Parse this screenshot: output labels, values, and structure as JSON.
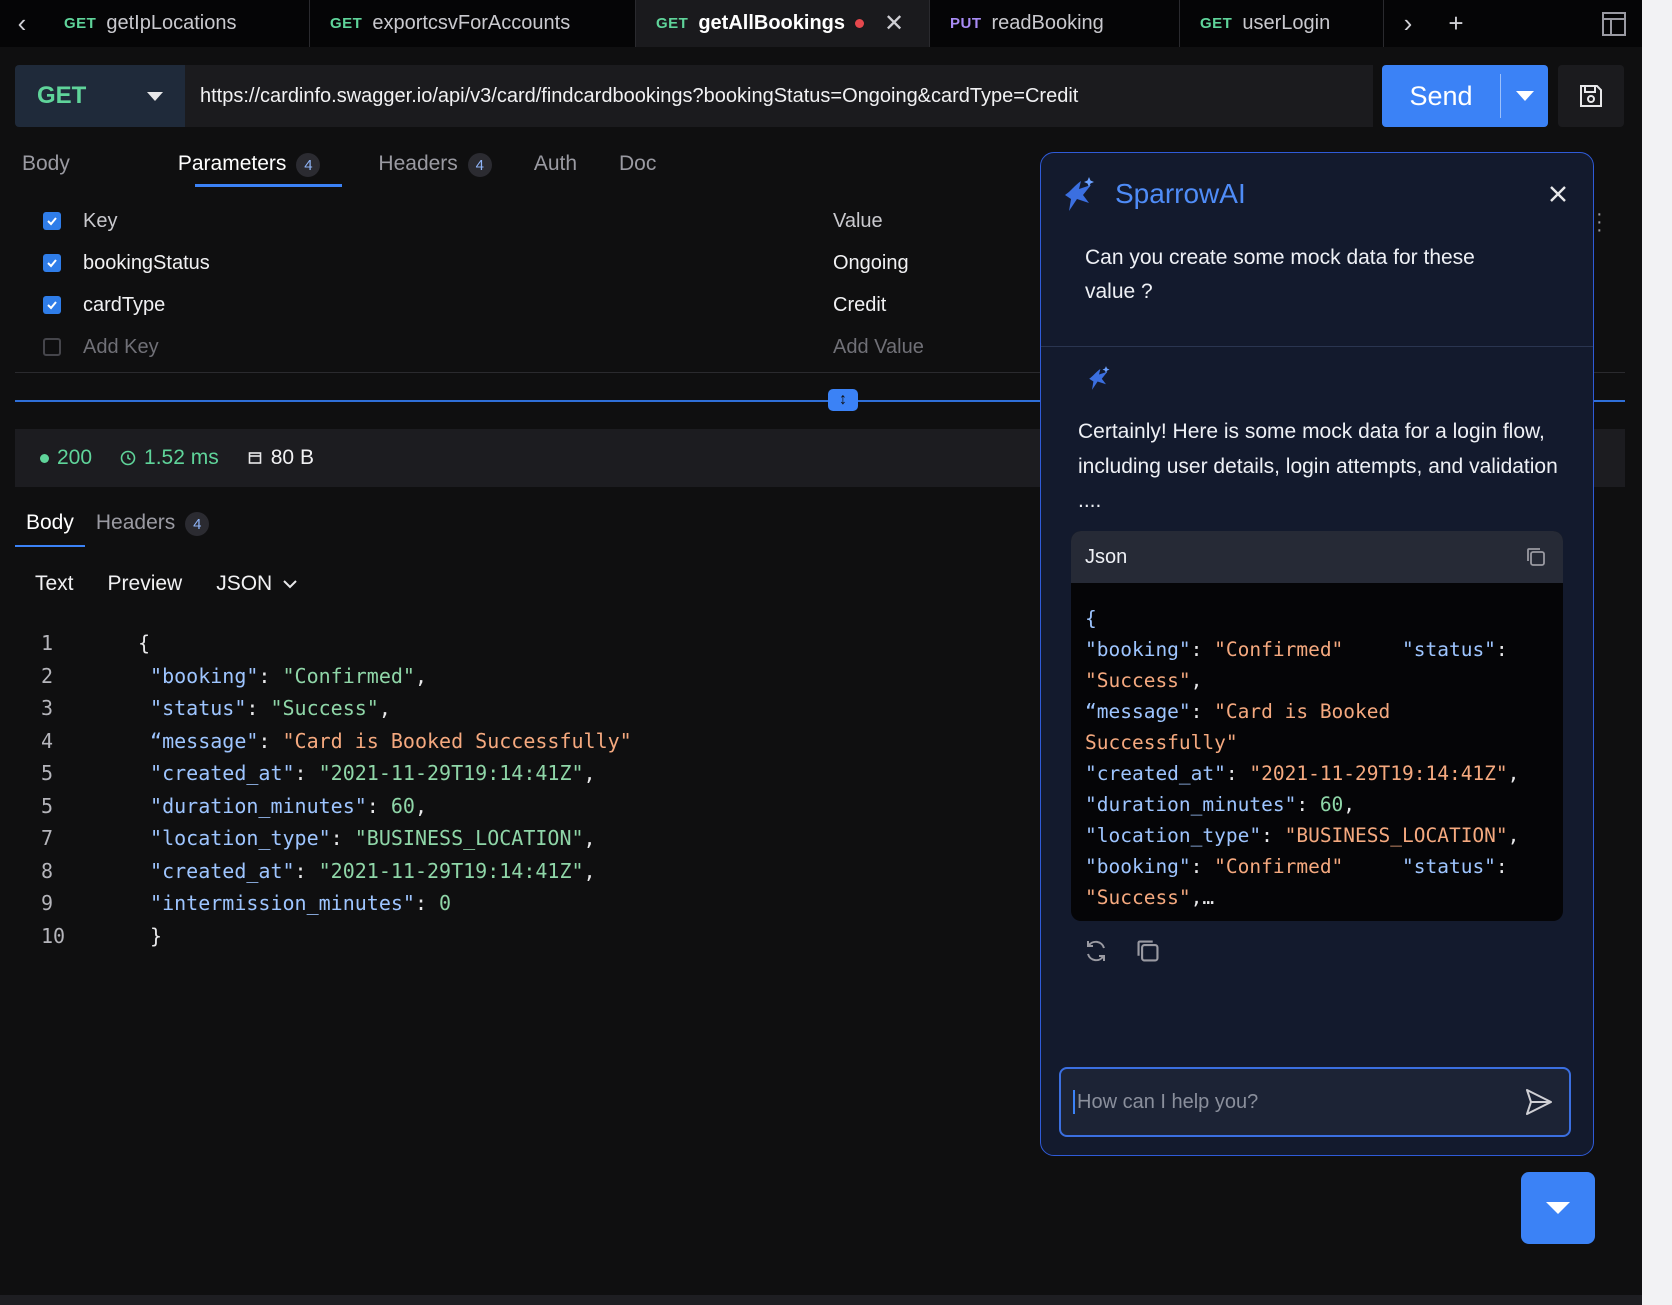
{
  "tabs": [
    {
      "method": "GET",
      "name": "getIpLocations",
      "active": false
    },
    {
      "method": "GET",
      "name": "exportcsvForAccounts",
      "active": false
    },
    {
      "method": "GET",
      "name": "getAllBookings",
      "active": true
    },
    {
      "method": "PUT",
      "name": "readBooking",
      "active": false
    },
    {
      "method": "GET",
      "name": "userLogin",
      "active": false
    }
  ],
  "request": {
    "method": "GET",
    "url": "https://cardinfo.swagger.io/api/v3/card/findcardbookings?bookingStatus=Ongoing&cardType=Credit",
    "send_label": "Send"
  },
  "request_tabs": [
    {
      "label": "Body",
      "badge": ""
    },
    {
      "label": "Parameters",
      "badge": "4"
    },
    {
      "label": "Headers",
      "badge": "4"
    },
    {
      "label": "Auth",
      "badge": ""
    },
    {
      "label": "Doc",
      "badge": ""
    }
  ],
  "params": {
    "header_key": "Key",
    "header_value": "Value",
    "rows": [
      {
        "key": "bookingStatus",
        "value": "Ongoing"
      },
      {
        "key": "cardType",
        "value": "Credit"
      }
    ],
    "add_key_placeholder": "Add Key",
    "add_value_placeholder": "Add Value"
  },
  "response": {
    "status_code": "200",
    "time": "1.52 ms",
    "size": "80 B",
    "tabs": [
      {
        "label": "Body",
        "badge": ""
      },
      {
        "label": "Headers",
        "badge": "4"
      }
    ],
    "view_tabs": [
      "Text",
      "Preview",
      "JSON"
    ],
    "line_numbers": [
      "1",
      "2",
      "3",
      "4",
      "5",
      "5",
      "7",
      "8",
      "9",
      "10"
    ]
  },
  "ai": {
    "title": "SparrowAI",
    "question": "Can you create some mock data for these value ?",
    "answer": "Certainly! Here is some mock data for a login flow, including user details, login attempts, and validation ....",
    "json_card_title": "Json",
    "input_placeholder": "How can I help you?"
  },
  "colors": {
    "accent": "#3b82f6",
    "get_method": "#5fd49a",
    "put_method": "#a98cf5",
    "unsaved_dot": "#e5484d",
    "panel_border": "#2f5bd8"
  },
  "icons": [
    "chevron-left-icon",
    "chevron-right-icon",
    "plus-icon",
    "layout-icon",
    "save-icon",
    "close-icon",
    "resize-icon",
    "clock-icon",
    "file-size-icon",
    "chevron-down-icon",
    "sparrow-logo-icon",
    "copy-icon",
    "regenerate-icon",
    "send-icon",
    "kebab-menu-icon",
    "trash-icon"
  ]
}
